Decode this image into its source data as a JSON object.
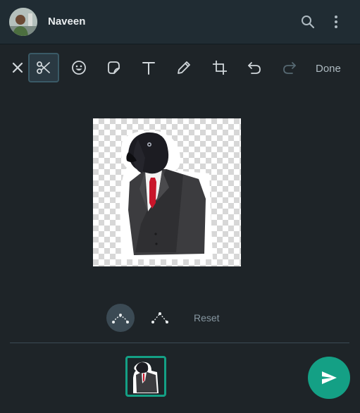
{
  "header": {
    "contact_name": "Naveen",
    "avatar_icon": "user-avatar",
    "search_icon": "search-icon",
    "menu_icon": "more-vertical-icon"
  },
  "toolbar": {
    "tools": [
      "close-icon",
      "scissors-icon",
      "emoji-icon",
      "sticker-icon",
      "text-icon",
      "pencil-icon",
      "crop-icon",
      "undo-icon",
      "redo-icon"
    ],
    "active_tool": "scissors-icon",
    "done_label": "Done"
  },
  "editor": {
    "shape_modes": [
      "curve-icon",
      "polygon-icon"
    ],
    "active_shape": "curve-icon",
    "reset_label": "Reset"
  },
  "footer": {
    "send_icon": "send-icon"
  },
  "colors": {
    "background": "#1e2428",
    "header": "#202c33",
    "accent": "#14a085"
  }
}
